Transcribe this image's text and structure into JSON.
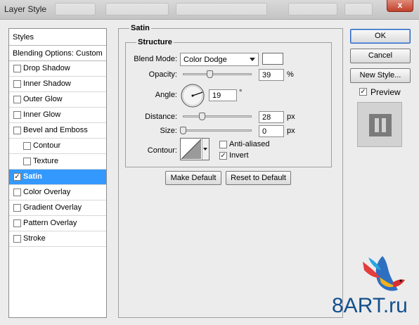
{
  "window": {
    "title": "Layer Style",
    "close_label": "x"
  },
  "styles_panel": {
    "header": "Styles",
    "blending_options": "Blending Options: Custom",
    "items": [
      {
        "label": "Drop Shadow",
        "checked": false,
        "sub": false,
        "selected": false
      },
      {
        "label": "Inner Shadow",
        "checked": false,
        "sub": false,
        "selected": false
      },
      {
        "label": "Outer Glow",
        "checked": false,
        "sub": false,
        "selected": false
      },
      {
        "label": "Inner Glow",
        "checked": false,
        "sub": false,
        "selected": false
      },
      {
        "label": "Bevel and Emboss",
        "checked": false,
        "sub": false,
        "selected": false
      },
      {
        "label": "Contour",
        "checked": false,
        "sub": true,
        "selected": false
      },
      {
        "label": "Texture",
        "checked": false,
        "sub": true,
        "selected": false
      },
      {
        "label": "Satin",
        "checked": true,
        "sub": false,
        "selected": true
      },
      {
        "label": "Color Overlay",
        "checked": false,
        "sub": false,
        "selected": false
      },
      {
        "label": "Gradient Overlay",
        "checked": false,
        "sub": false,
        "selected": false
      },
      {
        "label": "Pattern Overlay",
        "checked": false,
        "sub": false,
        "selected": false
      },
      {
        "label": "Stroke",
        "checked": false,
        "sub": false,
        "selected": false
      }
    ]
  },
  "satin": {
    "group_title": "Satin",
    "structure_title": "Structure",
    "blend_mode_label": "Blend Mode:",
    "blend_mode_value": "Color Dodge",
    "blend_color": "#ffffff",
    "opacity_label": "Opacity:",
    "opacity_value": "39",
    "opacity_unit": "%",
    "opacity_level": 0.39,
    "angle_label": "Angle:",
    "angle_value": "19",
    "angle_unit": "°",
    "distance_label": "Distance:",
    "distance_value": "28",
    "distance_unit": "px",
    "distance_level": 0.28,
    "size_label": "Size:",
    "size_value": "0",
    "size_unit": "px",
    "size_level": 0.0,
    "contour_label": "Contour:",
    "anti_aliased_label": "Anti-aliased",
    "anti_aliased_checked": false,
    "invert_label": "Invert",
    "invert_checked": true,
    "make_default_label": "Make Default",
    "reset_default_label": "Reset to Default"
  },
  "actions": {
    "ok_label": "OK",
    "cancel_label": "Cancel",
    "new_style_label": "New Style...",
    "preview_label": "Preview",
    "preview_checked": true
  },
  "watermark": {
    "text": "8ART.ru"
  },
  "colors": {
    "selection": "#3399ff",
    "accent": "#2a62b8"
  }
}
